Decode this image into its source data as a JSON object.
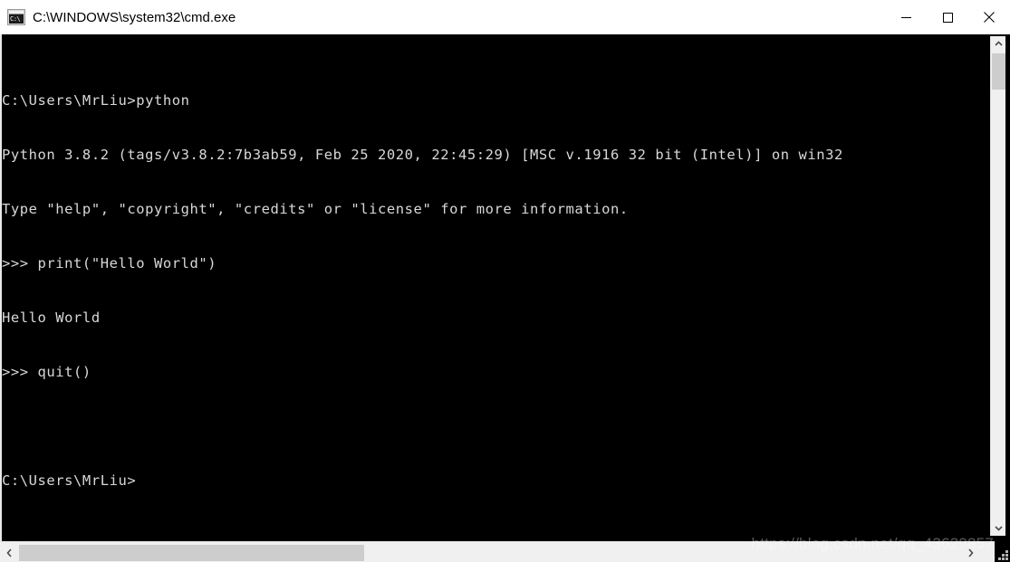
{
  "window": {
    "title": "C:\\WINDOWS\\system32\\cmd.exe",
    "icon_name": "cmd-console-icon",
    "icon_glyph": "C:\\",
    "background_color": "#000000",
    "titlebar_color": "#ffffff",
    "text_color": "#d8d8d8",
    "controls": {
      "minimize_label": "Minimize",
      "maximize_label": "Maximize",
      "close_label": "Close"
    }
  },
  "console": {
    "lines": [
      "C:\\Users\\MrLiu>python",
      "Python 3.8.2 (tags/v3.8.2:7b3ab59, Feb 25 2020, 22:45:29) [MSC v.1916 32 bit (Intel)] on win32",
      "Type \"help\", \"copyright\", \"credits\" or \"license\" for more information.",
      ">>> print(\"Hello World\")",
      "Hello World",
      ">>> quit()",
      "",
      "C:\\Users\\MrLiu>"
    ]
  },
  "scrollbars": {
    "vertical": {
      "up_arrow": "scroll-up-icon",
      "down_arrow": "scroll-down-icon",
      "thumb_position_percent": 3
    },
    "horizontal": {
      "left_arrow": "scroll-left-icon",
      "right_arrow": "scroll-right-icon",
      "thumb_position_percent": 0
    }
  },
  "watermark": {
    "text": "https://blog.csdn.net/qq_43629857"
  }
}
